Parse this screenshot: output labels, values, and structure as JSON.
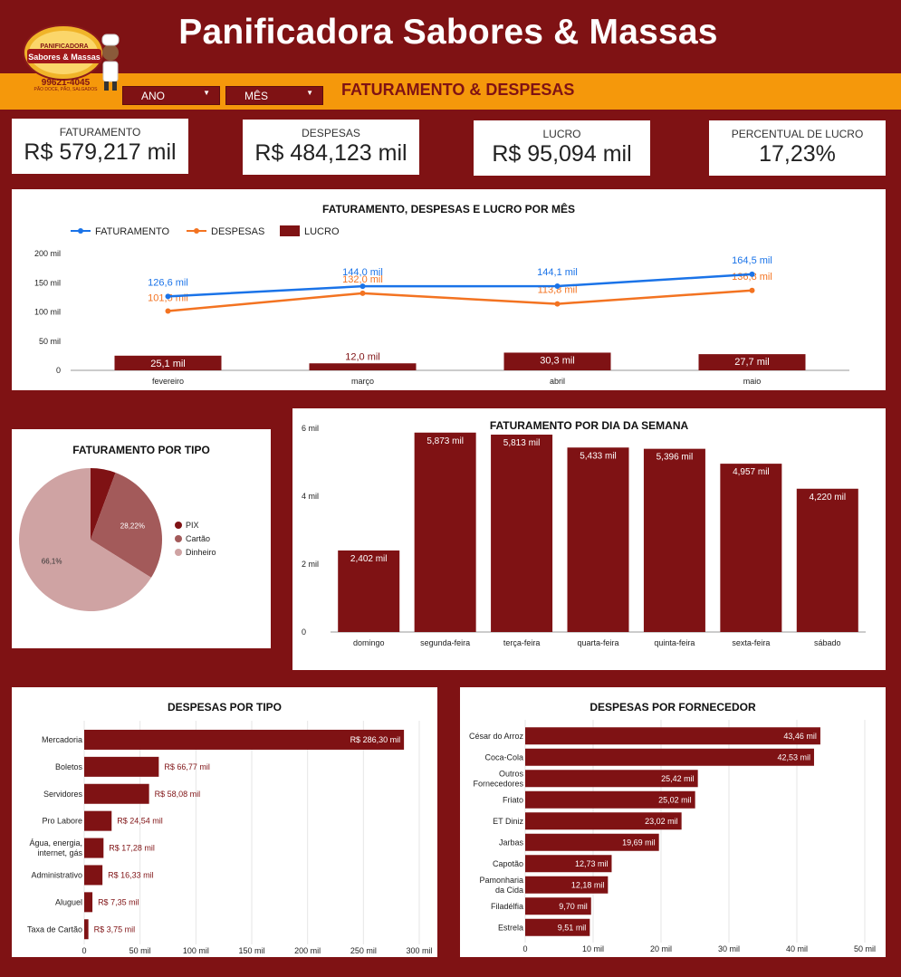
{
  "header": {
    "title": "Panificadora Sabores & Massas",
    "subtitle": "FATURAMENTO & DESPESAS",
    "logo": {
      "line1": "PANIFICADORA",
      "line2": "Sabores & Massas",
      "phone": "99621-4045",
      "tagline": "PÃO DOCE, PÃO, SALGADOS"
    },
    "filters": [
      {
        "label": "ANO"
      },
      {
        "label": "MÊS"
      }
    ]
  },
  "kpis": [
    {
      "label": "FATURAMENTO",
      "value": "R$ 579,217 mil"
    },
    {
      "label": "DESPESAS",
      "value": "R$ 484,123 mil"
    },
    {
      "label": "LUCRO",
      "value": "R$ 95,094 mil"
    },
    {
      "label": "PERCENTUAL DE LUCRO",
      "value": "17,23%"
    }
  ],
  "chart_data": [
    {
      "id": "monthly",
      "type": "bar",
      "title": "FATURAMENTO, DESPESAS E LUCRO POR MÊS",
      "categories": [
        "fevereiro",
        "março",
        "abril",
        "maio"
      ],
      "ylim": [
        0,
        200
      ],
      "yticks": [
        0,
        50,
        100,
        150,
        200
      ],
      "ytick_labels": [
        "0",
        "50 mil",
        "100 mil",
        "150 mil",
        "200 mil"
      ],
      "legend": "top-left",
      "series": [
        {
          "name": "FATURAMENTO",
          "type": "line",
          "color": "#1a73e8",
          "values": [
            126.6,
            144.0,
            144.1,
            164.5
          ],
          "labels": [
            "126,6 mil",
            "144,0 mil",
            "144,1 mil",
            "164,5 mil"
          ]
        },
        {
          "name": "DESPESAS",
          "type": "line",
          "color": "#f37321",
          "values": [
            101.5,
            132.0,
            113.8,
            136.8
          ],
          "labels": [
            "101,5 mil",
            "132,0 mil",
            "113,8 mil",
            "136,8 mil"
          ]
        },
        {
          "name": "LUCRO",
          "type": "bar",
          "color": "#7f1214",
          "values": [
            25.1,
            12.0,
            30.3,
            27.7
          ],
          "labels": [
            "25,1 mil",
            "12,0 mil",
            "30,3 mil",
            "27,7 mil"
          ]
        }
      ]
    },
    {
      "id": "pie",
      "type": "pie",
      "title": "FATURAMENTO POR TIPO",
      "legend": "right",
      "labels": [
        "PIX",
        "Cartão",
        "Dinheiro"
      ],
      "values": [
        5.68,
        28.22,
        66.1
      ],
      "slice_labels": [
        "",
        "28,22%",
        "66,1%"
      ],
      "colors": [
        "#7f1214",
        "#a35a5a",
        "#cfa3a3"
      ]
    },
    {
      "id": "weekday",
      "type": "bar",
      "title": "FATURAMENTO POR DIA DA SEMANA",
      "categories": [
        "domingo",
        "segunda-feira",
        "terça-feira",
        "quarta-feira",
        "quinta-feira",
        "sexta-feira",
        "sábado"
      ],
      "values": [
        2.402,
        5.873,
        5.813,
        5.433,
        5.396,
        4.957,
        4.22
      ],
      "labels": [
        "2,402 mil",
        "5,873 mil",
        "5,813 mil",
        "5,433 mil",
        "5,396 mil",
        "4,957 mil",
        "4,220 mil"
      ],
      "ylim": [
        0,
        6
      ],
      "yticks": [
        0,
        2,
        4,
        6
      ],
      "ytick_labels": [
        "0",
        "2 mil",
        "4 mil",
        "6 mil"
      ],
      "color": "#7f1214"
    },
    {
      "id": "expense_type",
      "type": "bar",
      "orientation": "horizontal",
      "title": "DESPESAS POR TIPO",
      "categories": [
        "Mercadoria",
        "Boletos",
        "Servidores",
        "Pro Labore",
        "Água, energia, internet, gás",
        "Administrativo",
        "Aluguel",
        "Taxa de Cartão"
      ],
      "values": [
        286.3,
        66.77,
        58.08,
        24.54,
        17.28,
        16.33,
        7.35,
        3.75
      ],
      "labels": [
        "R$ 286,30 mil",
        "R$ 66,77 mil",
        "R$ 58,08 mil",
        "R$ 24,54 mil",
        "R$ 17,28 mil",
        "R$ 16,33 mil",
        "R$ 7,35 mil",
        "R$ 3,75 mil"
      ],
      "xlim": [
        0,
        300
      ],
      "xticks": [
        0,
        50,
        100,
        150,
        200,
        250,
        300
      ],
      "xtick_labels": [
        "0",
        "50 mil",
        "100 mil",
        "150 mil",
        "200 mil",
        "250 mil",
        "300 mil"
      ],
      "grid": true,
      "color": "#7f1214"
    },
    {
      "id": "supplier",
      "type": "bar",
      "orientation": "horizontal",
      "title": "DESPESAS POR FORNECEDOR",
      "categories": [
        "César do Arroz",
        "Coca-Cola",
        "Outros Fornecedores",
        "Friato",
        "ET Diniz",
        "Jarbas",
        "Capotão",
        "Pamonharia da Cida",
        "Filadélfia",
        "Estrela"
      ],
      "values": [
        43.46,
        42.53,
        25.42,
        25.02,
        23.02,
        19.69,
        12.73,
        12.18,
        9.7,
        9.51
      ],
      "labels": [
        "43,46 mil",
        "42,53 mil",
        "25,42 mil",
        "25,02 mil",
        "23,02 mil",
        "19,69 mil",
        "12,73 mil",
        "12,18 mil",
        "9,70 mil",
        "9,51 mil"
      ],
      "xlim": [
        0,
        50
      ],
      "xticks": [
        0,
        10,
        20,
        30,
        40,
        50
      ],
      "xtick_labels": [
        "0",
        "10 mil",
        "20 mil",
        "30 mil",
        "40 mil",
        "50 mil"
      ],
      "grid": true,
      "color": "#7f1214"
    }
  ]
}
